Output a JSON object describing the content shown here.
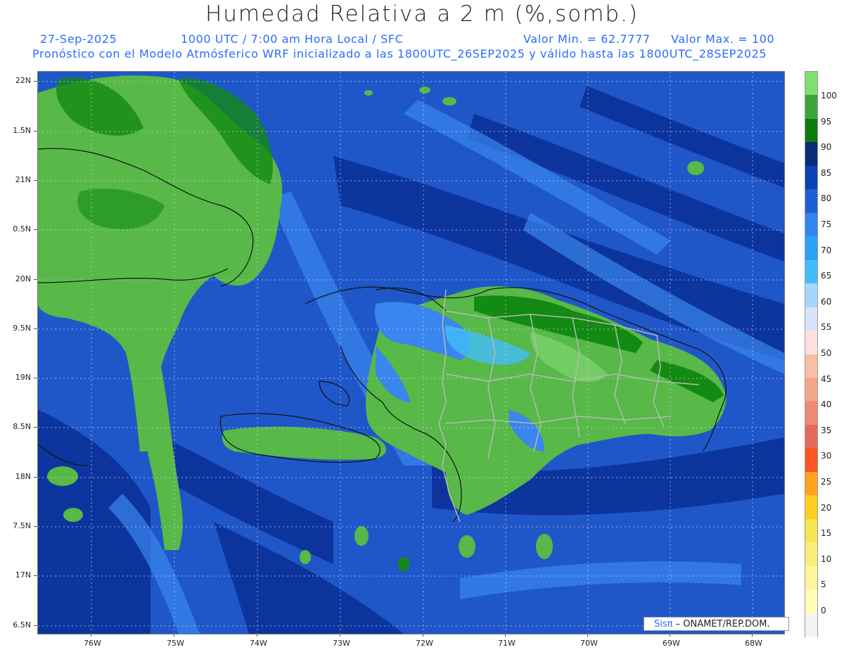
{
  "header": {
    "title": "Humedad Relativa a 2 m (%,somb.)",
    "date": "27-Sep-2025",
    "time": "1000 UTC / 7:00 am Hora Local / SFC",
    "min": "Valor Min. = 62.7777",
    "max": "Valor Max. = 100",
    "model": "Pronóstico con el Modelo Atmósferico WRF inicializado a las 1800UTC_26SEP2025 y válido hasta las  1800UTC_28SEP2025"
  },
  "map": {
    "lat_labels": [
      "22N",
      "1.5N",
      "21N",
      "0.5N",
      "20N",
      "9.5N",
      "19N",
      "8.5N",
      "18N",
      "7.5N",
      "17N",
      "6.5N"
    ],
    "lon_labels": [
      "76W",
      "75W",
      "74W",
      "73W",
      "72W",
      "71W",
      "70W",
      "69W",
      "68W"
    ],
    "colors": {
      "ocean_deep": "#0a2f96",
      "ocean": "#1f57c8",
      "ocean_light": "#3a86ee",
      "land": "#58b848",
      "land_dark": "#138a13",
      "land_bright": "#8fe27f",
      "borders": "#b8b8b8",
      "coast": "#111111"
    }
  },
  "colorbar": {
    "labels": [
      "100",
      "95",
      "90",
      "85",
      "80",
      "75",
      "70",
      "65",
      "60",
      "55",
      "50",
      "45",
      "40",
      "35",
      "30",
      "25",
      "20",
      "15",
      "10",
      "5",
      "0"
    ],
    "colors": [
      "#7ee070",
      "#3aa63a",
      "#0b7d0b",
      "#0a2a7a",
      "#0b43b3",
      "#1e5fd6",
      "#2f86ee",
      "#2aa2f5",
      "#42bdfa",
      "#a4d8fb",
      "#d9e2f7",
      "#fde1e1",
      "#f7bfa6",
      "#f2a789",
      "#ec8c72",
      "#e66a5a",
      "#ff5522",
      "#ffa41c",
      "#ffcd22",
      "#f7e450",
      "#f9ed7a",
      "#fcf59c",
      "#fffcb8",
      "#f3f3f3"
    ]
  },
  "credit": {
    "brand": "Sisπ",
    "text": "– ONAMET/REP.DOM."
  }
}
